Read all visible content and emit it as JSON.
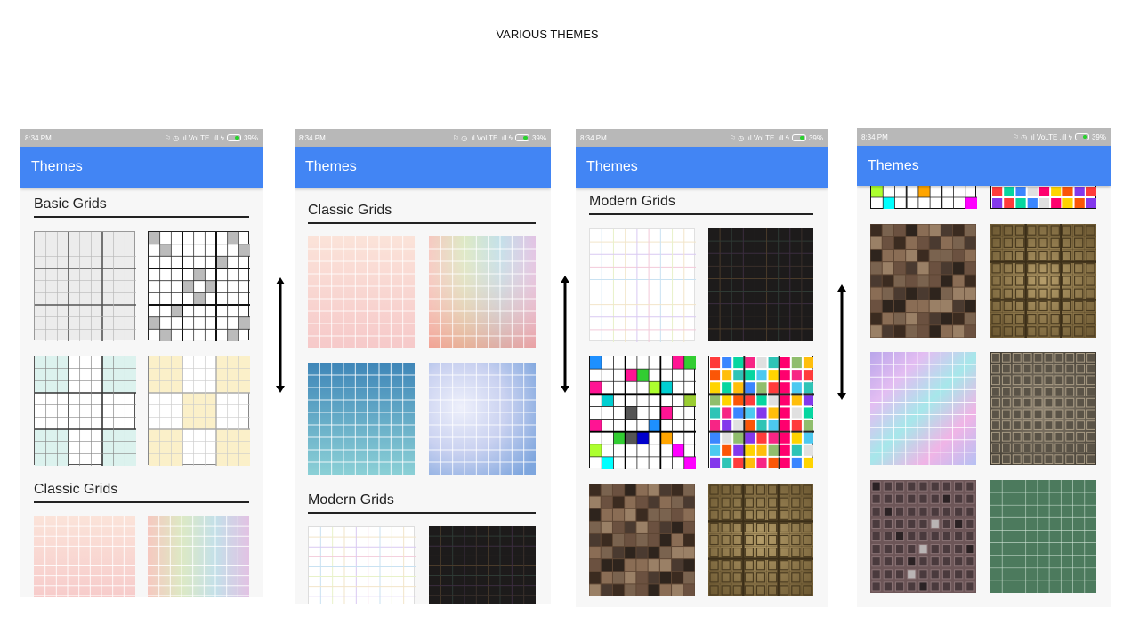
{
  "page": {
    "title": "VARIOUS THEMES"
  },
  "status_bar": {
    "time": "8:34 PM",
    "indicators": "⚐ ◷ .ıl VoLTE .ıll ϟ",
    "battery": "39%"
  },
  "app_bar": {
    "title": "Themes"
  },
  "sections": {
    "basic": "Basic Grids",
    "classic": "Classic Grids",
    "modern": "Modern Grids"
  },
  "icons": {
    "scroll_indicator": "double-headed-vertical-arrow-icon"
  },
  "colors": {
    "app_bar": "#4285f4",
    "status_bar": "#b8b8b8",
    "screen_background": "#f7f7f7",
    "battery_fill": "#28d12c"
  }
}
